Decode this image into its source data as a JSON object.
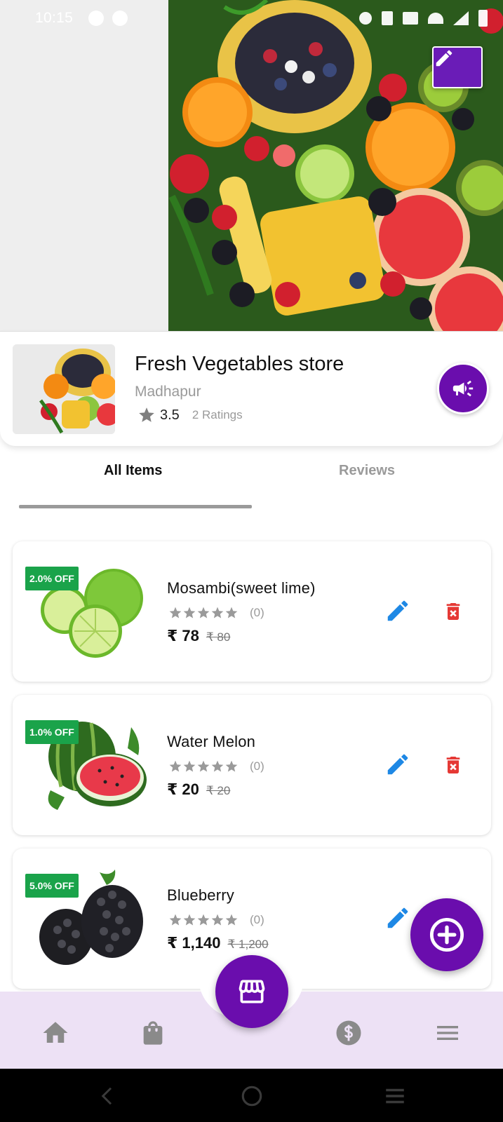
{
  "status_bar": {
    "time": "10:15"
  },
  "store": {
    "name": "Fresh Vegetables store",
    "location": "Madhapur",
    "rating": "3.5",
    "ratings_count": "2 Ratings"
  },
  "tabs": [
    {
      "label": "All Items",
      "active": true
    },
    {
      "label": "Reviews",
      "active": false
    }
  ],
  "items": [
    {
      "name": "Mosambi(sweet lime)",
      "discount": "2.0% OFF",
      "rating_count": "(0)",
      "price": "₹ 78",
      "mrp": "₹ 80"
    },
    {
      "name": "Water Melon",
      "discount": "1.0% OFF",
      "rating_count": "(0)",
      "price": "₹ 20",
      "mrp": "₹ 20"
    },
    {
      "name": "Blueberry",
      "discount": "5.0% OFF",
      "rating_count": "(0)",
      "price": "₹ 1,140",
      "mrp": "₹ 1,200"
    }
  ],
  "bottom_nav": [
    "home-icon",
    "shopping-bag-icon",
    "store-icon",
    "dollar-icon",
    "menu-icon"
  ],
  "colors": {
    "primary": "#6a0dad",
    "discount": "#1aa34a",
    "edit": "#1e88e5",
    "delete": "#e53935",
    "nav_bg": "#ede1f5"
  }
}
